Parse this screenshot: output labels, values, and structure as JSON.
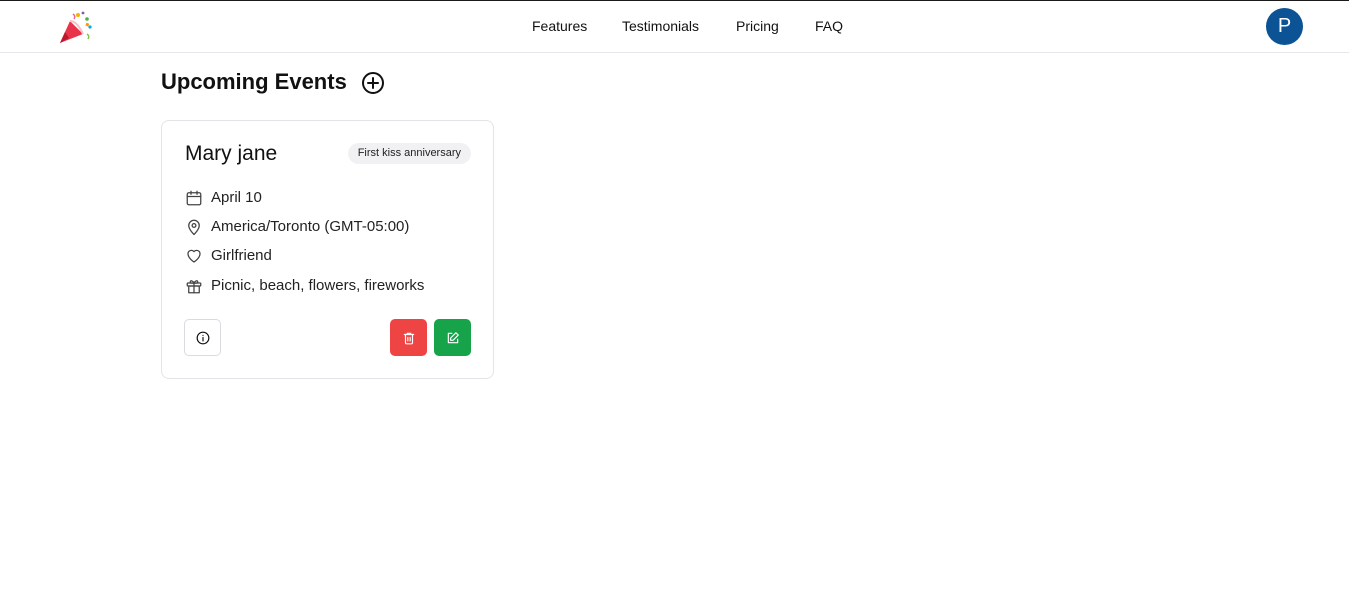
{
  "header": {
    "logo_icon": "party-popper-icon",
    "nav": [
      {
        "label": "Features"
      },
      {
        "label": "Testimonials"
      },
      {
        "label": "Pricing"
      },
      {
        "label": "FAQ"
      }
    ],
    "avatar_initial": "P",
    "avatar_color": "#0b5394"
  },
  "main": {
    "title": "Upcoming Events",
    "add_icon": "plus-circle-icon"
  },
  "events": [
    {
      "name": "Mary jane",
      "occasion": "First kiss anniversary",
      "date": "April 10",
      "timezone": "America/Toronto (GMT-05:00)",
      "relationship": "Girlfriend",
      "gift_ideas": "Picnic, beach, flowers, fireworks",
      "icons": [
        "calendar-icon",
        "map-pin-icon",
        "heart-icon",
        "gift-icon"
      ],
      "actions": [
        {
          "icon": "info-icon",
          "color": "#ffffff"
        },
        {
          "icon": "trash-icon",
          "color": "#ef4444"
        },
        {
          "icon": "edit-icon",
          "color": "#16a34a"
        }
      ]
    }
  ]
}
